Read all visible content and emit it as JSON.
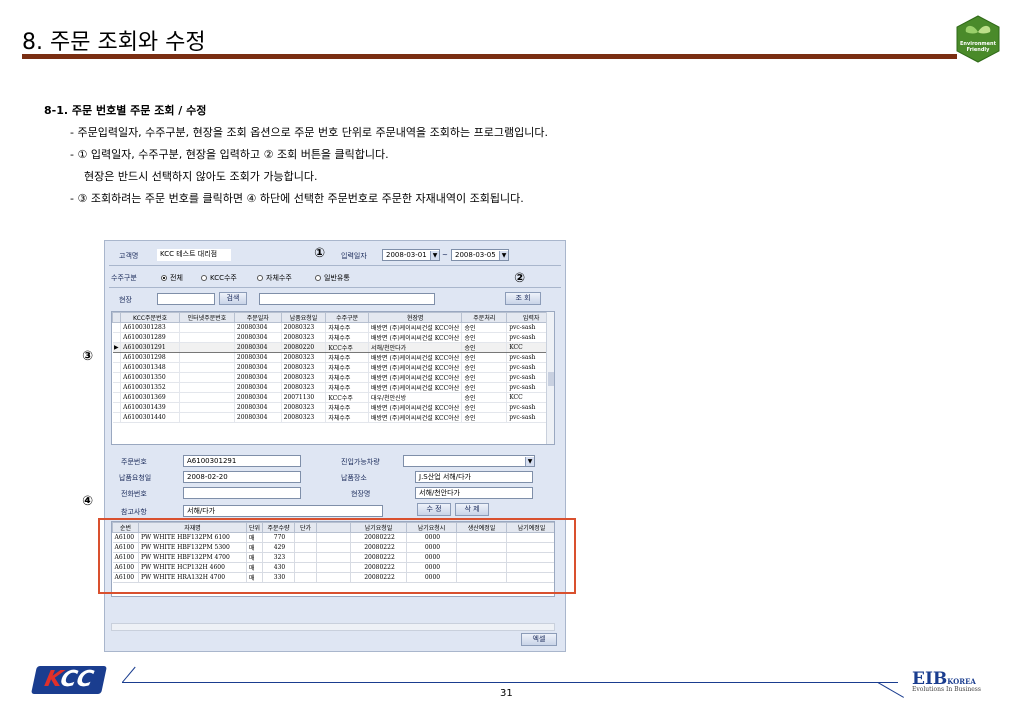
{
  "slide": {
    "title": "8. 주문 조회와 수정",
    "page_number": "31"
  },
  "logos": {
    "env_line1": "Environment",
    "env_line2": "Friendly",
    "kcc_k": "K",
    "kcc_rest": "CC",
    "eib_main": "EIB",
    "eib_korea": "KOREA",
    "eib_tagline": "Evolutions In Business"
  },
  "section": {
    "heading": "8-1. 주문 번호별 주문 조회 / 수정",
    "lines": [
      "- 주문입력일자, 수주구분, 현장을 조회 옵션으로 주문 번호 단위로 주문내역을 조회하는 프로그램입니다.",
      "- ① 입력일자, 수주구분, 현장을 입력하고 ② 조회 버튼을 클릭합니다.",
      "현장은 반드시 선택하지 않아도 조회가 가능합니다.",
      "- ③ 조회하려는 주문 번호를 클릭하면 ④ 하단에 선택한 주문번호로 주문한 자재내역이 조회됩니다."
    ]
  },
  "markers": {
    "m1": "①",
    "m2": "②",
    "m3": "③",
    "m4": "④"
  },
  "app": {
    "customer_label": "고객명",
    "customer_value": "KCC 테스트 대리점",
    "input_date_label": "입력일자",
    "date_from": "2008-03-01",
    "date_tilde": "~",
    "date_to": "2008-03-05",
    "order_type_label": "수주구분",
    "radio_all": "전체",
    "radio_kcc": "KCC수주",
    "radio_self": "자체수주",
    "radio_general": "일반유통",
    "site_label": "현장",
    "search_button": "검색",
    "query_button": "조 회",
    "grid_headers": [
      "KCC주문번호",
      "인터넷주문번호",
      "주문일자",
      "납품요청일",
      "수주구분",
      "현장명",
      "주문처리",
      "입력자"
    ],
    "grid_rows": [
      [
        "A6100301283",
        "",
        "20080304",
        "20080323",
        "자체수주",
        "배방면 (주)케이씨씨건설 KCC아산",
        "승인",
        "pvc-sash"
      ],
      [
        "A6100301289",
        "",
        "20080304",
        "20080323",
        "자체수주",
        "배방면 (주)케이씨씨건설 KCC아산",
        "승인",
        "pvc-sash"
      ],
      [
        "A6100301291",
        "",
        "20080304",
        "20080220",
        "KCC수주",
        "서해/천안다가",
        "승인",
        "KCC"
      ],
      [
        "A6100301298",
        "",
        "20080304",
        "20080323",
        "자체수주",
        "배방면 (주)케이씨씨건설 KCC아산",
        "승인",
        "pvc-sash"
      ],
      [
        "A6100301348",
        "",
        "20080304",
        "20080323",
        "자체수주",
        "배방면 (주)케이씨씨건설 KCC아산",
        "승인",
        "pvc-sash"
      ],
      [
        "A6100301350",
        "",
        "20080304",
        "20080323",
        "자체수주",
        "배방면 (주)케이씨씨건설 KCC아산",
        "승인",
        "pvc-sash"
      ],
      [
        "A6100301352",
        "",
        "20080304",
        "20080323",
        "자체수주",
        "배방면 (주)케이씨씨건설 KCC아산",
        "승인",
        "pvc-sash"
      ],
      [
        "A6100301369",
        "",
        "20080304",
        "20071130",
        "KCC수주",
        "대우/천안신방",
        "승인",
        "KCC"
      ],
      [
        "A6100301439",
        "",
        "20080304",
        "20080323",
        "자체수주",
        "배방면 (주)케이씨씨건설 KCC아산",
        "승인",
        "pvc-sash"
      ],
      [
        "A6100301440",
        "",
        "20080304",
        "20080323",
        "자체수주",
        "배방면 (주)케이씨씨건설 KCC아산",
        "승인",
        "pvc-sash"
      ]
    ],
    "selected_row_index": 2,
    "detail": {
      "order_no_label": "주문번호",
      "order_no_value": "A6100301291",
      "delivery_req_label": "납품요청일",
      "delivery_req_value": "2008-02-20",
      "phone_label": "전화번호",
      "phone_value": "",
      "memo_label": "참고사항",
      "memo_value": "서해/다가",
      "entry_label": "진입가능차량",
      "entry_value": "",
      "place_label": "납품장소",
      "place_value": "J.S산업 서해/다가",
      "site_name_label": "현장명",
      "site_name_value": "서해/천안다가",
      "modify_button": "수 정",
      "delete_button": "삭 제"
    },
    "sub_headers": [
      "순번",
      "자재명",
      "단위",
      "주문수량",
      "단가",
      "",
      "납기요청일",
      "납기요청시",
      "생산예정일",
      "납기예정일"
    ],
    "sub_rows": [
      [
        "A6100",
        "PW WHITE HBF132PM 6100",
        "매",
        "770",
        "",
        "",
        "20080222",
        "0000",
        "",
        ""
      ],
      [
        "A6100",
        "PW WHITE HBF132PM 5300",
        "매",
        "429",
        "",
        "",
        "20080222",
        "0000",
        "",
        ""
      ],
      [
        "A6100",
        "PW WHITE HBF132PM 4700",
        "매",
        "323",
        "",
        "",
        "20080222",
        "0000",
        "",
        ""
      ],
      [
        "A6100",
        "PW WHITE HCP132H 4600",
        "매",
        "430",
        "",
        "",
        "20080222",
        "0000",
        "",
        ""
      ],
      [
        "A6100",
        "PW WHITE HRA132H 4700",
        "매",
        "330",
        "",
        "",
        "20080222",
        "0000",
        "",
        ""
      ]
    ],
    "excel_button": "엑셀"
  },
  "colors": {
    "title_bar": "#7a2e12",
    "highlight_box": "#d9502e",
    "brand_blue": "#1a3d8f",
    "kcc_red": "#e0302a"
  }
}
